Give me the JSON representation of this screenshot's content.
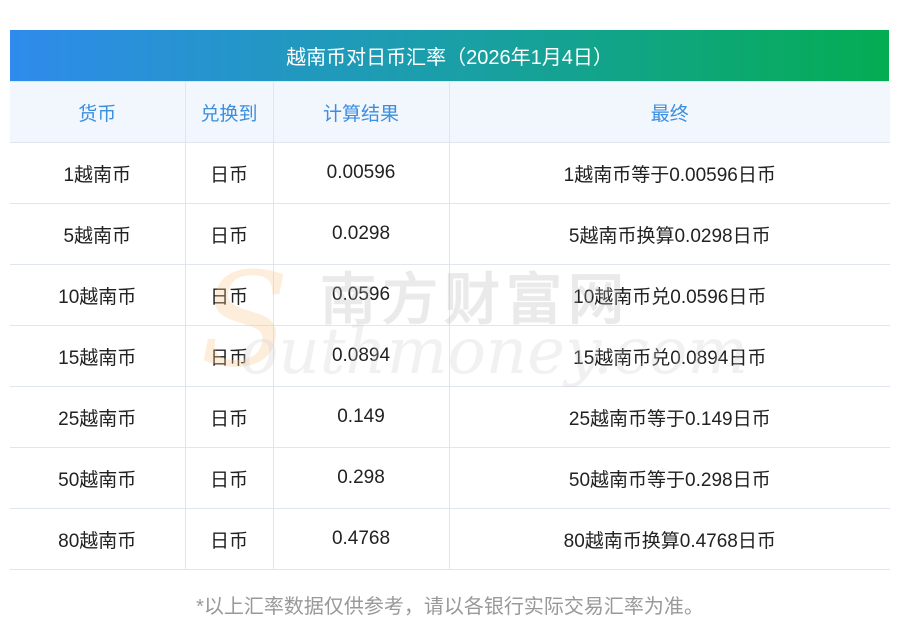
{
  "title": "越南币对日币汇率（2026年1月4日）",
  "headers": [
    "货币",
    "兑换到",
    "计算结果",
    "最终"
  ],
  "rows": [
    [
      "1越南币",
      "日币",
      "0.00596",
      "1越南币等于0.00596日币"
    ],
    [
      "5越南币",
      "日币",
      "0.0298",
      "5越南币换算0.0298日币"
    ],
    [
      "10越南币",
      "日币",
      "0.0596",
      "10越南币兑0.0596日币"
    ],
    [
      "15越南币",
      "日币",
      "0.0894",
      "15越南币兑0.0894日币"
    ],
    [
      "25越南币",
      "日币",
      "0.149",
      "25越南币等于0.149日币"
    ],
    [
      "50越南币",
      "日币",
      "0.298",
      "50越南币等于0.298日币"
    ],
    [
      "80越南币",
      "日币",
      "0.4768",
      "80越南币换算0.4768日币"
    ]
  ],
  "watermark": {
    "cn": "南方财富网",
    "en": "Southmoney.com"
  },
  "footer": "*以上汇率数据仅供参考，请以各银行实际交易汇率为准。"
}
